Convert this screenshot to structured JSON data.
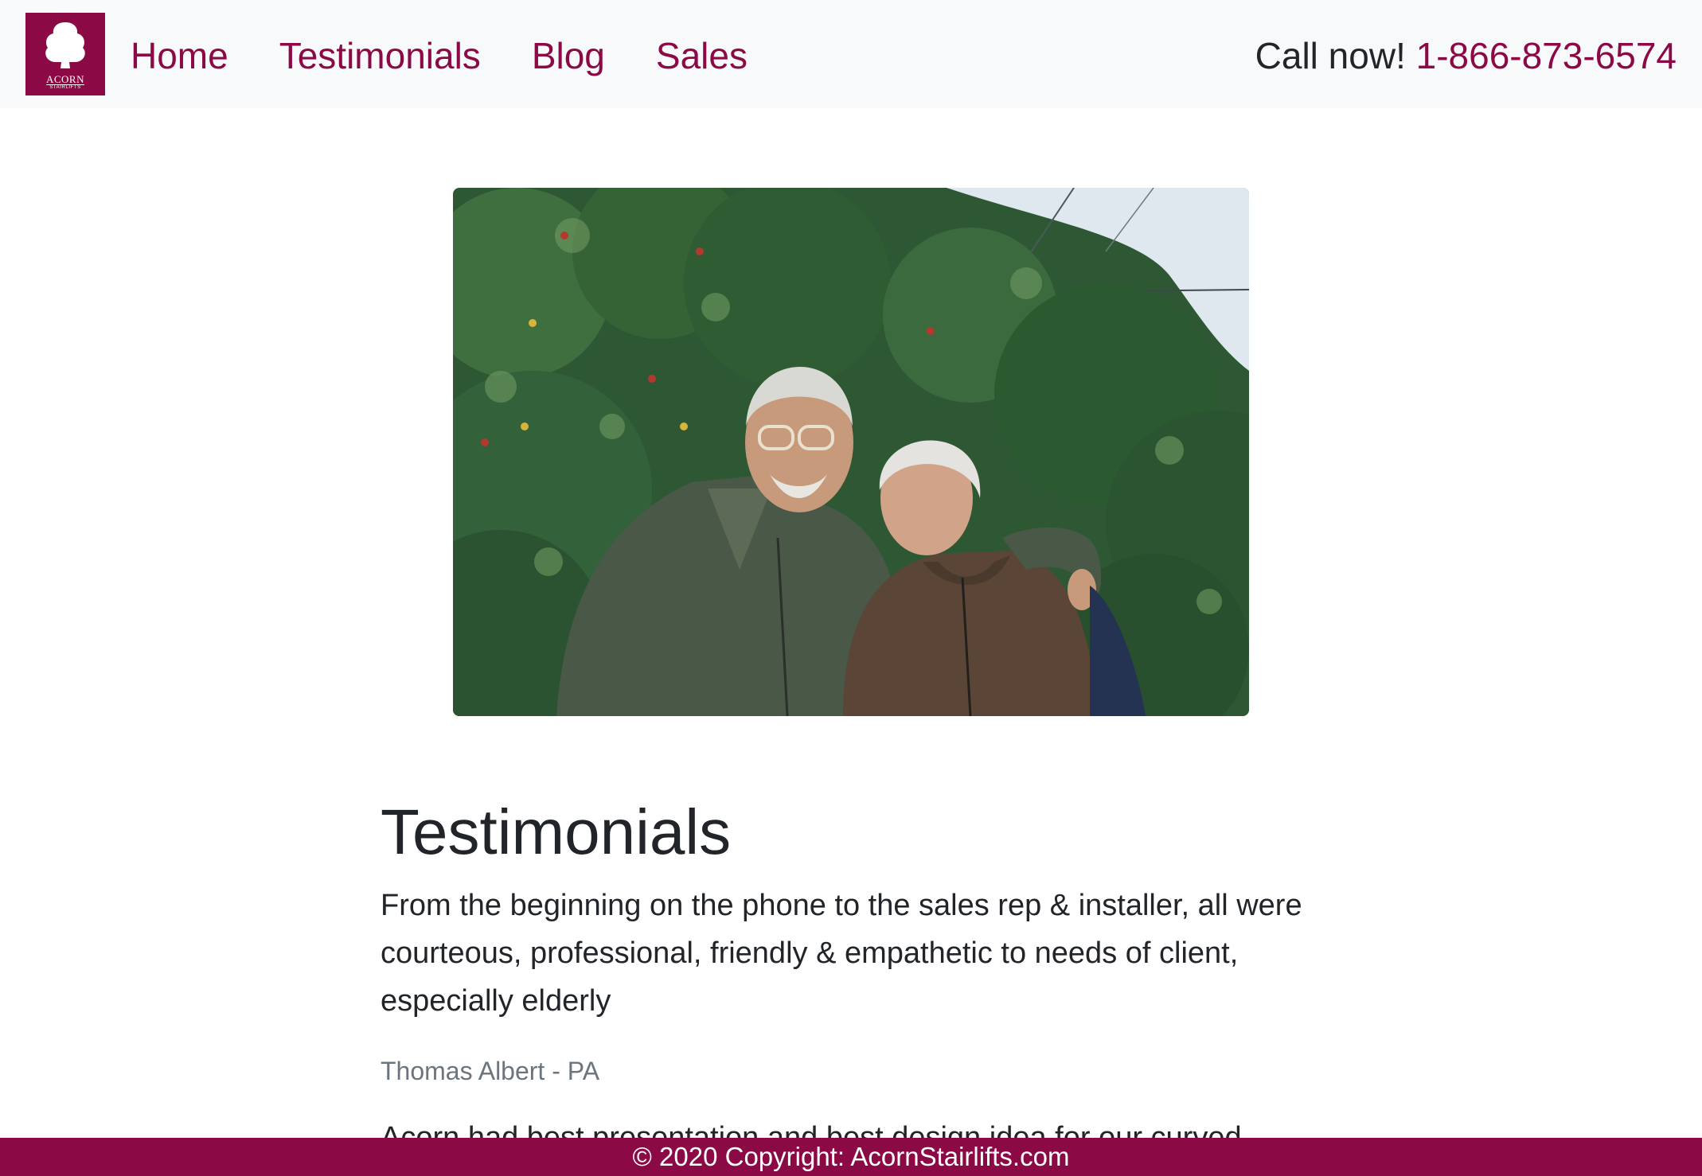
{
  "navbar": {
    "brand": {
      "name": "ACORN",
      "sub": "STAIRLIFTS",
      "logo_icon": "acorn-tree-icon"
    },
    "links": [
      {
        "label": "Home"
      },
      {
        "label": "Testimonials"
      },
      {
        "label": "Blog"
      },
      {
        "label": "Sales"
      }
    ],
    "call_label": "Call now!",
    "phone": "1-866-873-6574"
  },
  "hero": {
    "alt": ""
  },
  "main": {
    "title": "Testimonials",
    "testimonials": [
      {
        "text": "From the beginning on the phone to the sales rep & installer, all were courteous, professional, friendly & empathetic to needs of client, especially elderly",
        "author": "Thomas Albert - PA"
      },
      {
        "text": "Acorn had best presentation and best design idea for our curved"
      }
    ]
  },
  "footer": {
    "text": "© 2020 Copyright: AcornStairlifts.com"
  },
  "colors": {
    "brand": "#8b0a45",
    "navbar_bg": "#f8f9fa",
    "text": "#212529",
    "muted": "#6c757d"
  }
}
